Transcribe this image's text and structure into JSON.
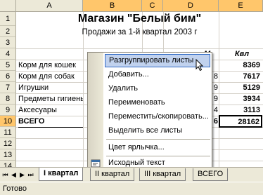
{
  "columns": [
    "A",
    "B",
    "C",
    "D",
    "E"
  ],
  "rows": [
    "1",
    "2",
    "3",
    "4",
    "5",
    "6",
    "7",
    "8",
    "9",
    "10",
    "11",
    "12",
    "13",
    "14"
  ],
  "sheet": {
    "title": "Магазин \"Белый бим\"",
    "subtitle": "Продажи за 1-й квартал 2003 г",
    "header_partial_b": "Б",
    "header_partial_d": "М",
    "header_partial_e": "Квл",
    "items": [
      "Корм для кошек",
      "Корм для собак",
      "Игрушки",
      "Предметы гигиены",
      "Аксесуары"
    ],
    "values": [
      "8369",
      "7617",
      "5129",
      "3934",
      "3113"
    ],
    "d_visible": [
      "",
      "8",
      "9",
      "9",
      "4"
    ],
    "total_label": "ВСЕГО",
    "total_value": "28162",
    "total_d": "6"
  },
  "context_menu": {
    "items": [
      {
        "label": "Разгруппировать листы"
      },
      {
        "label": "Добавить..."
      },
      {
        "label": "Удалить"
      },
      {
        "label": "Переименовать"
      },
      {
        "label": "Переместить/скопировать..."
      },
      {
        "label": "Выделить все листы"
      },
      {
        "label": "Цвет ярлычка..."
      },
      {
        "label": "Исходный текст"
      }
    ]
  },
  "tabs": [
    "I квартал",
    "II квартал",
    "III квартал",
    "ВСЕГО"
  ],
  "status": "Готово",
  "colors": {
    "selected_header": "#ffc66b",
    "menu_highlight": "#c1d2ee",
    "menu_border": "#316ac5"
  }
}
